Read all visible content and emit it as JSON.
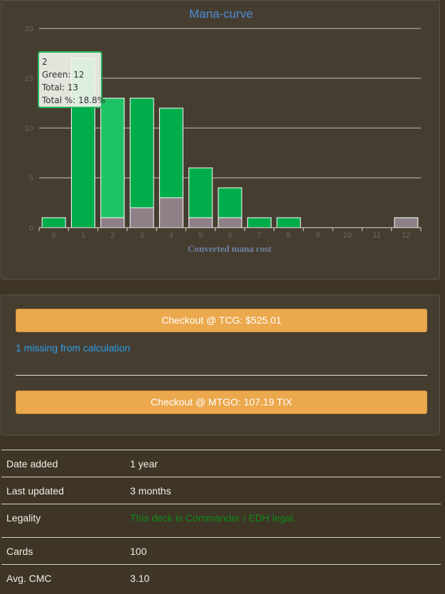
{
  "chart_data": {
    "type": "bar",
    "title": "Mana-curve",
    "xlabel": "Converted mana cost",
    "ylabel": "",
    "ylim": [
      0,
      20
    ],
    "yticks": [
      "0",
      "5",
      "10",
      "15",
      "20"
    ],
    "categories": [
      "0",
      "1",
      "2",
      "3",
      "4",
      "5",
      "6",
      "7",
      "8",
      "9",
      "10",
      "11",
      "12"
    ],
    "series": [
      {
        "name": "Green",
        "color": "#00ad4b",
        "values": [
          1,
          17,
          12,
          11,
          9,
          5,
          3,
          1,
          1,
          0,
          0,
          0,
          0
        ]
      },
      {
        "name": "",
        "color": "#8e8086",
        "values": [
          0,
          0,
          1,
          2,
          3,
          1,
          1,
          0,
          0,
          0,
          0,
          0,
          1
        ]
      }
    ],
    "highlighted_category": "2",
    "highlight_color": "#1ec364",
    "grid": true,
    "legend": "none"
  },
  "tooltip": {
    "line1": "2",
    "line2": "Green: 12",
    "line3": "Total: 13",
    "line4": "Total %: 18.8%"
  },
  "checkout": {
    "tcg_label": "Checkout @ TCG: $525.01",
    "missing_text": "1 missing from calculation",
    "mtgo_label": "Checkout @ MTGO: 107.19 TIX"
  },
  "info": [
    {
      "key": "Date added",
      "value": "1 year"
    },
    {
      "key": "Last updated",
      "value": "3 months"
    },
    {
      "key": "Legality",
      "value": "This deck is Commander / EDH legal."
    },
    {
      "key": "Cards",
      "value": "100"
    },
    {
      "key": "Avg. CMC",
      "value": "3.10"
    }
  ]
}
